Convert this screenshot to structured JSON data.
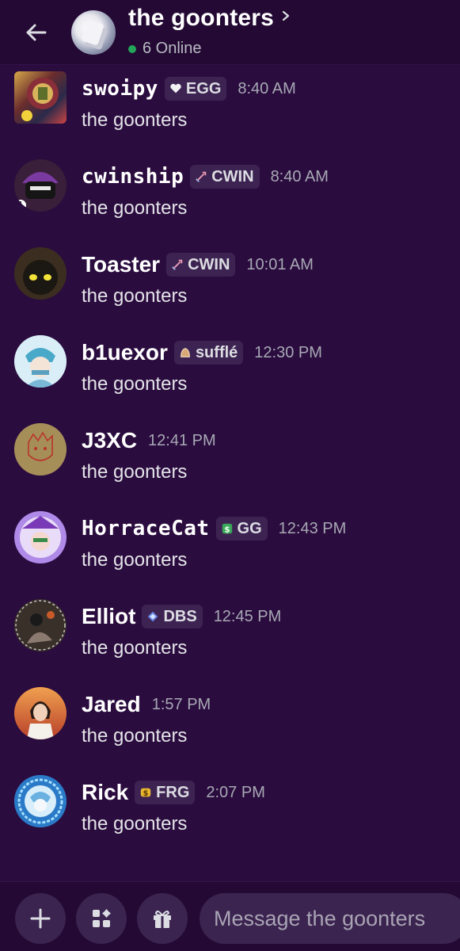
{
  "header": {
    "title": "the goonters",
    "online": "6 Online"
  },
  "messages": [
    {
      "username": "swoipy",
      "tag": "EGG",
      "tag_icon": "heart-icon",
      "time": "8:40 AM",
      "text": "the goonters"
    },
    {
      "username": "cwinship",
      "tag": "CWIN",
      "tag_icon": "sword-icon",
      "time": "8:40 AM",
      "text": "the goonters"
    },
    {
      "username": "Toaster",
      "tag": "CWIN",
      "tag_icon": "sword-icon",
      "time": "10:01 AM",
      "text": "the goonters"
    },
    {
      "username": "b1uexor",
      "tag": "sufflé",
      "tag_icon": "bread-icon",
      "time": "12:30 PM",
      "text": "the goonters"
    },
    {
      "username": "J3XC",
      "tag": "",
      "tag_icon": "",
      "time": "12:41 PM",
      "text": "the goonters"
    },
    {
      "username": "HorraceCat",
      "tag": "GG",
      "tag_icon": "dollar-icon",
      "time": "12:43 PM",
      "text": "the goonters"
    },
    {
      "username": "Elliot",
      "tag": "DBS",
      "tag_icon": "diamond-icon",
      "time": "12:45 PM",
      "text": "the goonters"
    },
    {
      "username": "Jared",
      "tag": "",
      "tag_icon": "",
      "time": "1:57 PM",
      "text": "the goonters"
    },
    {
      "username": "Rick",
      "tag": "FRG",
      "tag_icon": "coin-icon",
      "time": "2:07 PM",
      "text": "the goonters"
    }
  ],
  "composer": {
    "placeholder": "Message the goonters"
  },
  "colors": {
    "background": "#2b0c3f",
    "header": "#230933",
    "tag_bg": "#3d2352",
    "online": "#23a55a"
  }
}
